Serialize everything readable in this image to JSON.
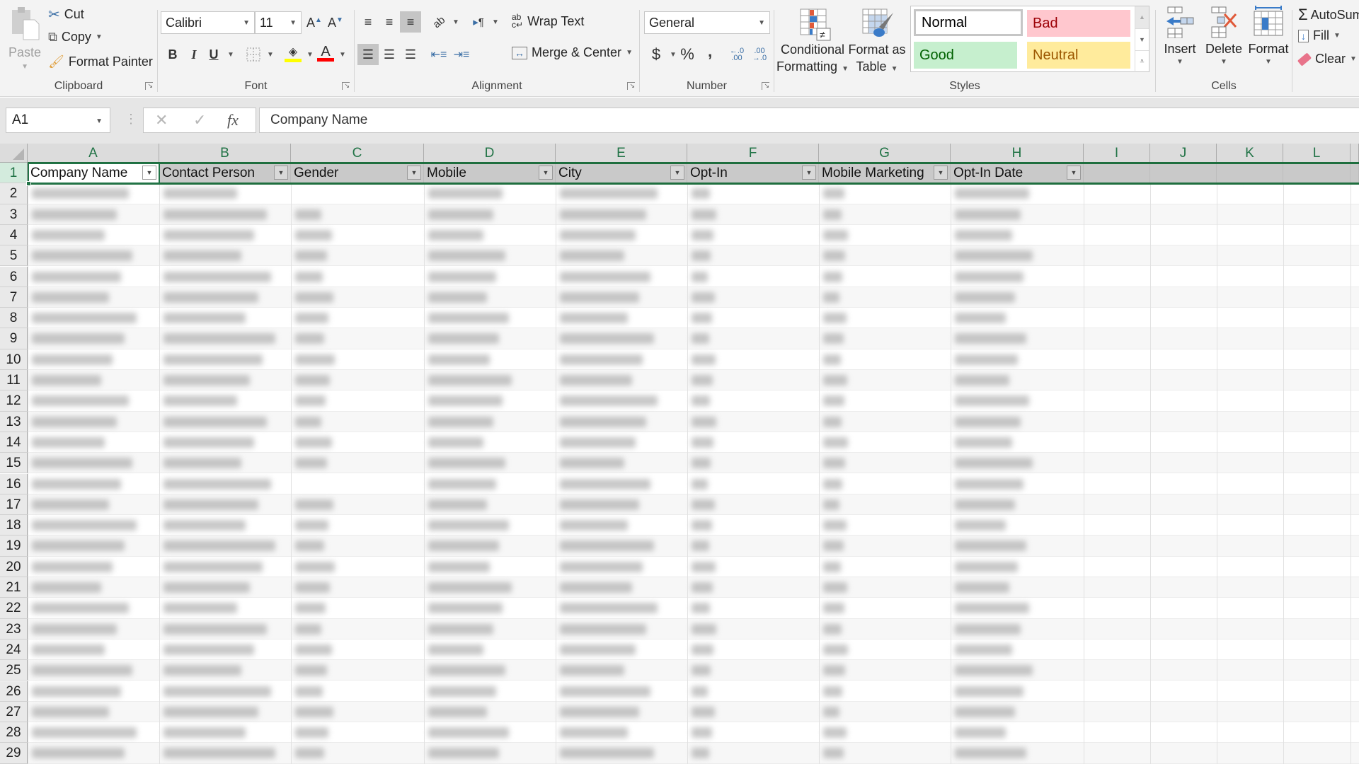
{
  "ribbon": {
    "clipboard": {
      "label": "Clipboard",
      "paste": "Paste",
      "cut": "Cut",
      "copy": "Copy",
      "format_painter": "Format Painter"
    },
    "font": {
      "label": "Font",
      "font_name": "Calibri",
      "font_size": "11",
      "bold": "B",
      "italic": "I",
      "underline": "U",
      "fill_color": "#ffff00",
      "font_color": "#ff0000"
    },
    "alignment": {
      "label": "Alignment",
      "wrap_text": "Wrap Text",
      "merge_center": "Merge & Center"
    },
    "number": {
      "label": "Number",
      "format": "General",
      "currency": "$",
      "percent": "%",
      "comma": ",",
      "inc_decimal": "←.0 .00",
      "dec_decimal": ".00 →.0"
    },
    "styles": {
      "label": "Styles",
      "conditional_formatting": [
        "Conditional",
        "Formatting"
      ],
      "format_as_table": [
        "Format as",
        "Table"
      ],
      "gallery": [
        {
          "name": "Normal",
          "bg": "#ffffff",
          "fg": "#000000"
        },
        {
          "name": "Bad",
          "bg": "#ffc7ce",
          "fg": "#9c0006"
        },
        {
          "name": "Good",
          "bg": "#c6efce",
          "fg": "#006100"
        },
        {
          "name": "Neutral",
          "bg": "#ffeb9c",
          "fg": "#9c5700"
        }
      ]
    },
    "cells": {
      "label": "Cells",
      "insert": "Insert",
      "delete": "Delete",
      "format": "Format"
    },
    "editing": {
      "autosum": "AutoSum",
      "fill": "Fill",
      "clear": "Clear"
    }
  },
  "formula_bar": {
    "name_box": "A1",
    "cancel": "✕",
    "enter": "✓",
    "fx": "fx",
    "content": "Company Name"
  },
  "sheet": {
    "columns": [
      "A",
      "B",
      "C",
      "D",
      "E",
      "F",
      "G",
      "H",
      "I",
      "J",
      "K",
      "L"
    ],
    "headers": [
      "Company Name",
      "Contact Person",
      "Gender",
      "Mobile",
      "City",
      "Opt-In",
      "Mobile Marketing",
      "Opt-In Date"
    ],
    "rows": [
      "1",
      "2",
      "3",
      "4",
      "5",
      "6",
      "7",
      "8",
      "9",
      "10",
      "11",
      "12",
      "13",
      "14",
      "15",
      "16",
      "17",
      "18",
      "19",
      "20",
      "21",
      "22",
      "23",
      "24",
      "25",
      "26",
      "27",
      "28",
      "29"
    ],
    "active_cell": "A1",
    "data_note": "Data cells in rows 2-29 are blurred and illegible",
    "accent_color": "#217346"
  }
}
